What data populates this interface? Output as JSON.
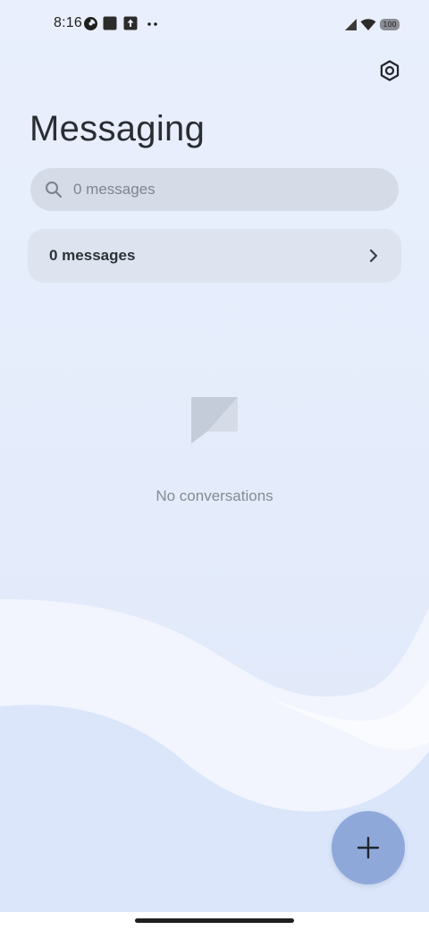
{
  "status_bar": {
    "time": "8:16",
    "battery": "100"
  },
  "header": {
    "title": "Messaging",
    "settings_icon": "settings-icon"
  },
  "search": {
    "placeholder": "0 messages",
    "value": ""
  },
  "messages_row": {
    "label": "0 messages"
  },
  "empty_state": {
    "icon": "message-bubble-icon",
    "text": "No conversations"
  },
  "fab": {
    "icon": "plus-icon"
  },
  "colors": {
    "background": "#e8effc",
    "search_bg": "#d5dce8",
    "row_bg": "#dde4f0",
    "fab_bg": "#8ea9d9",
    "text_primary": "#2a2d33",
    "text_secondary": "#868b94"
  }
}
